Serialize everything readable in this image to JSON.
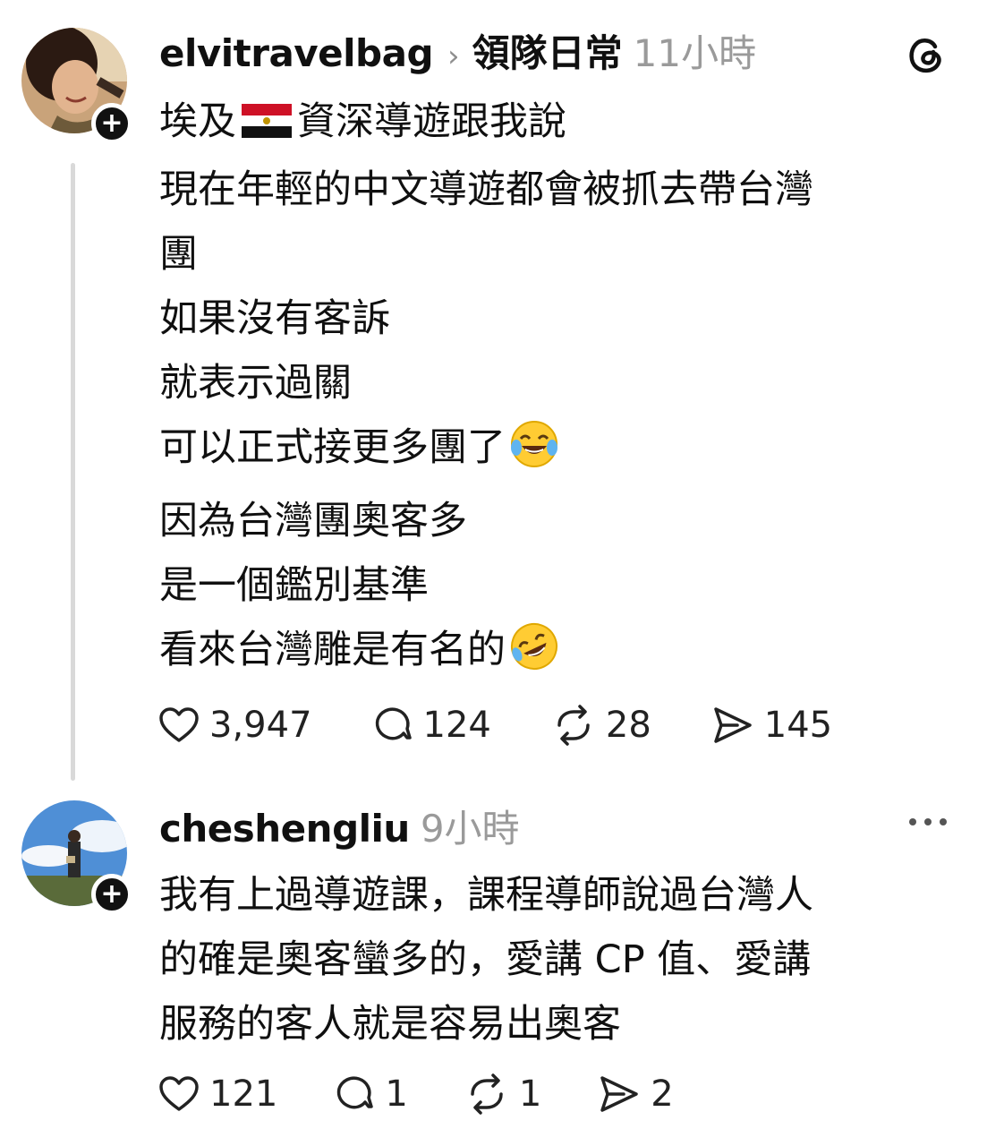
{
  "post": {
    "username": "elvitravelbag",
    "topic": "領隊日常",
    "time": "11小時",
    "lines": [
      "埃及",
      "資深導遊跟我說",
      "現在年輕的中文導遊都會被抓去帶台灣",
      "團",
      "如果沒有客訴",
      "就表示過關",
      "可以正式接更多團了",
      "因為台灣團奧客多",
      "是一個鑑別基準",
      "看來台灣雕是有名的"
    ],
    "likes": "3,947",
    "replies": "124",
    "reposts": "28",
    "shares": "145",
    "icons": [
      "flag-egypt-icon",
      "tears-of-joy-emoji-icon",
      "rofl-emoji-icon",
      "threads-logo-icon"
    ]
  },
  "reply": {
    "username": "cheshengliu",
    "time": "9小時",
    "lines": [
      "我有上過導遊課，課程導師說過台灣人",
      "的確是奧客蠻多的，愛講 CP 值、愛講",
      "服務的客人就是容易出奧客"
    ],
    "likes": "121",
    "replies": "1",
    "reposts": "1",
    "shares": "2",
    "icons": [
      "more-options-icon"
    ]
  },
  "colors": {
    "text": "#101010",
    "muted": "#9a9a9a",
    "line": "#d9d9d9"
  }
}
